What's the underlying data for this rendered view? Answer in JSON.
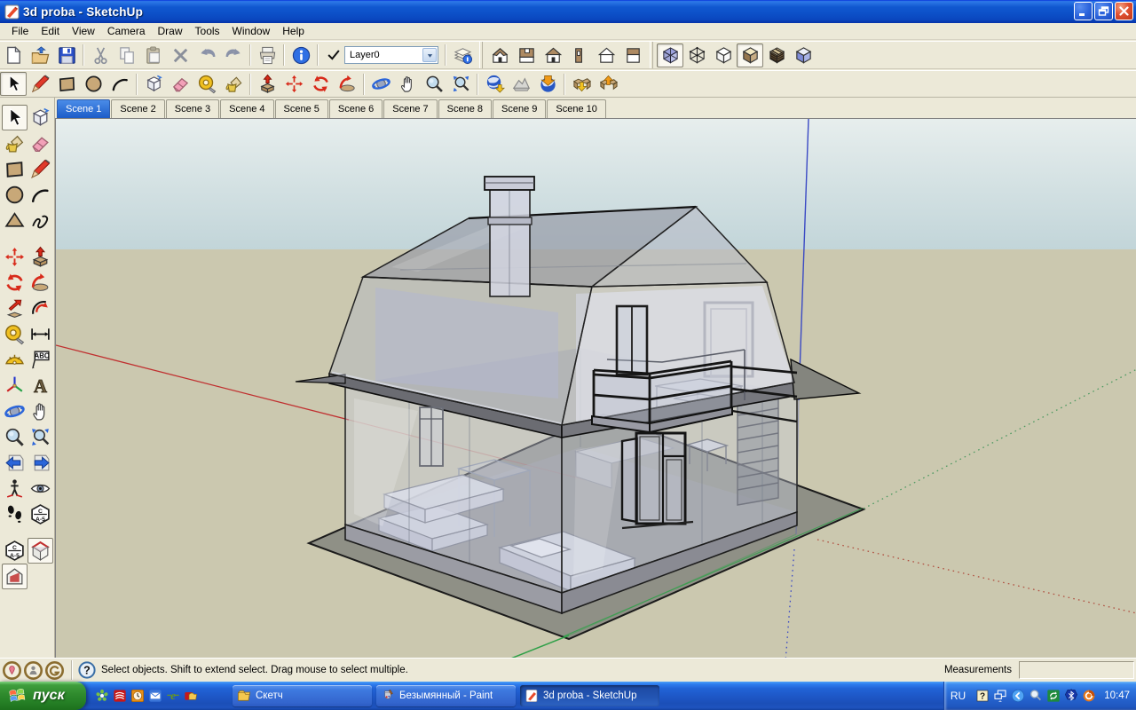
{
  "window": {
    "title": "3d proba - SketchUp",
    "icon": "sketchup-logo",
    "controls": [
      {
        "icon": "minimize-icon",
        "name": "minimize"
      },
      {
        "icon": "restore-icon",
        "name": "restore"
      },
      {
        "icon": "close-icon",
        "name": "close"
      }
    ]
  },
  "menu": {
    "items": [
      "File",
      "Edit",
      "View",
      "Camera",
      "Draw",
      "Tools",
      "Window",
      "Help"
    ]
  },
  "toolbar_row1": {
    "sections": [
      {
        "kind": "buttons",
        "tools": [
          {
            "icon": "new"
          },
          {
            "icon": "open"
          },
          {
            "icon": "save"
          }
        ]
      },
      {
        "kind": "buttons",
        "tools": [
          {
            "icon": "cut"
          },
          {
            "icon": "copy"
          },
          {
            "icon": "paste"
          },
          {
            "icon": "erase"
          },
          {
            "icon": "undo"
          },
          {
            "icon": "redo"
          }
        ]
      },
      {
        "kind": "buttons",
        "tools": [
          {
            "icon": "print"
          }
        ]
      },
      {
        "kind": "buttons",
        "tools": [
          {
            "icon": "model-info"
          }
        ]
      },
      {
        "kind": "layer-combo",
        "selected_layer": "Layer0"
      },
      {
        "kind": "buttons",
        "tools": [
          {
            "icon": "layer-manager"
          }
        ]
      },
      {
        "kind": "edge"
      },
      {
        "kind": "buttons",
        "tools": [
          {
            "icon": "view-iso"
          },
          {
            "icon": "view-top"
          },
          {
            "icon": "view-front"
          },
          {
            "icon": "view-right"
          },
          {
            "icon": "view-back"
          },
          {
            "icon": "view-left"
          }
        ]
      },
      {
        "kind": "edge"
      },
      {
        "kind": "buttons",
        "tools": [
          {
            "icon": "style-xray",
            "pressed": true
          },
          {
            "icon": "style-wireframe"
          },
          {
            "icon": "style-hidden-line"
          },
          {
            "icon": "style-shaded",
            "pressed": true
          },
          {
            "icon": "style-textured"
          },
          {
            "icon": "style-monochrome"
          }
        ]
      }
    ]
  },
  "toolbar_row2": {
    "sections": [
      {
        "kind": "buttons",
        "tools": [
          {
            "icon": "select",
            "pressed": true
          },
          {
            "icon": "line"
          },
          {
            "icon": "rectangle"
          },
          {
            "icon": "circle"
          },
          {
            "icon": "arc"
          }
        ]
      },
      {
        "kind": "buttons",
        "tools": [
          {
            "icon": "make-component"
          },
          {
            "icon": "eraser"
          },
          {
            "icon": "tape-measure"
          },
          {
            "icon": "paint-bucket"
          }
        ]
      },
      {
        "kind": "buttons",
        "tools": [
          {
            "icon": "push-pull"
          },
          {
            "icon": "move"
          },
          {
            "icon": "rotate"
          },
          {
            "icon": "follow-me"
          }
        ]
      },
      {
        "kind": "buttons",
        "tools": [
          {
            "icon": "orbit"
          },
          {
            "icon": "pan"
          },
          {
            "icon": "zoom"
          },
          {
            "icon": "zoom-extents"
          }
        ]
      },
      {
        "kind": "buttons",
        "tools": [
          {
            "icon": "ge-get-view"
          },
          {
            "icon": "ge-toggle-terrain"
          },
          {
            "icon": "ge-place-model"
          }
        ]
      },
      {
        "kind": "buttons",
        "tools": [
          {
            "icon": "get-models"
          },
          {
            "icon": "share-model"
          }
        ]
      }
    ]
  },
  "tool_palette": {
    "rows": [
      [
        {
          "icon": "select",
          "pressed": true
        },
        {
          "icon": "make-component"
        }
      ],
      [
        {
          "icon": "paint-bucket"
        },
        {
          "icon": "eraser"
        }
      ],
      [
        {
          "icon": "rectangle"
        },
        {
          "icon": "line"
        }
      ],
      [
        {
          "icon": "circle"
        },
        {
          "icon": "arc"
        }
      ],
      [
        {
          "icon": "polygon"
        },
        {
          "icon": "freehand"
        }
      ],
      [
        {
          "icon": "gap"
        }
      ],
      [
        {
          "icon": "move"
        },
        {
          "icon": "push-pull"
        }
      ],
      [
        {
          "icon": "rotate"
        },
        {
          "icon": "follow-me"
        }
      ],
      [
        {
          "icon": "scale"
        },
        {
          "icon": "offset"
        }
      ],
      [
        {
          "icon": "tape-measure"
        },
        {
          "icon": "dimension"
        }
      ],
      [
        {
          "icon": "protractor"
        },
        {
          "icon": "text"
        }
      ],
      [
        {
          "icon": "axes"
        },
        {
          "icon": "text-3d"
        }
      ],
      [
        {
          "icon": "orbit"
        },
        {
          "icon": "pan"
        }
      ],
      [
        {
          "icon": "zoom"
        },
        {
          "icon": "zoom-extents"
        }
      ],
      [
        {
          "icon": "previous-view"
        },
        {
          "icon": "next-view"
        }
      ],
      [
        {
          "icon": "position-camera"
        },
        {
          "icon": "look-around"
        }
      ],
      [
        {
          "icon": "walk"
        },
        {
          "icon": "section-plane"
        }
      ],
      [
        {
          "icon": "gap"
        }
      ],
      [
        {
          "icon": "section-display"
        },
        {
          "icon": "section-cut",
          "pressed": true
        }
      ],
      [
        {
          "icon": "section-fill",
          "pressed": true
        }
      ]
    ]
  },
  "scene_tabs": {
    "tabs": [
      {
        "label": "Scene 1",
        "active": true
      },
      {
        "label": "Scene 2"
      },
      {
        "label": "Scene 3"
      },
      {
        "label": "Scene 4"
      },
      {
        "label": "Scene 5"
      },
      {
        "label": "Scene 6"
      },
      {
        "label": "Scene 7"
      },
      {
        "label": "Scene 8"
      },
      {
        "label": "Scene 9"
      },
      {
        "label": "Scene 10"
      }
    ]
  },
  "viewport": {
    "sky_top_color": "#E6EDEC",
    "sky_horizon_color": "#C2D5D9",
    "ground_color": "#CBC8AF",
    "axis_colors": {
      "red": "#C03030",
      "green": "#2FA048",
      "blue": "#3A49C4"
    },
    "model": "transparent x-ray house with gambrel roof, chimney, balcony and furniture"
  },
  "status_bar": {
    "icons": [
      "geolocation-badge",
      "attribution-badge",
      "signin-badge"
    ],
    "help_icon": "help-circle",
    "message": "Select objects. Shift to extend select. Drag mouse to select multiple.",
    "measurements_label": "Measurements",
    "measurements_value": ""
  },
  "taskbar": {
    "start_label": "пуск",
    "start_icon": "windows-flag",
    "quick_launch": [
      "icq-flower",
      "solidworks",
      "clock-app",
      "mail-app",
      "internet-e",
      "red-folder-app"
    ],
    "tasks": [
      {
        "icon": "folder",
        "label": "Скетч"
      },
      {
        "icon": "paint",
        "label": "Безымянный - Paint"
      },
      {
        "icon": "sketchup",
        "label": "3d proba - SketchUp",
        "active": true
      }
    ],
    "tray": {
      "language": "RU",
      "icons": [
        "help-badge",
        "display-settings",
        "collapse-chevron",
        "magnifier-tray",
        "sync-green",
        "bluetooth",
        "download-manager"
      ],
      "clock": "10:47"
    }
  }
}
